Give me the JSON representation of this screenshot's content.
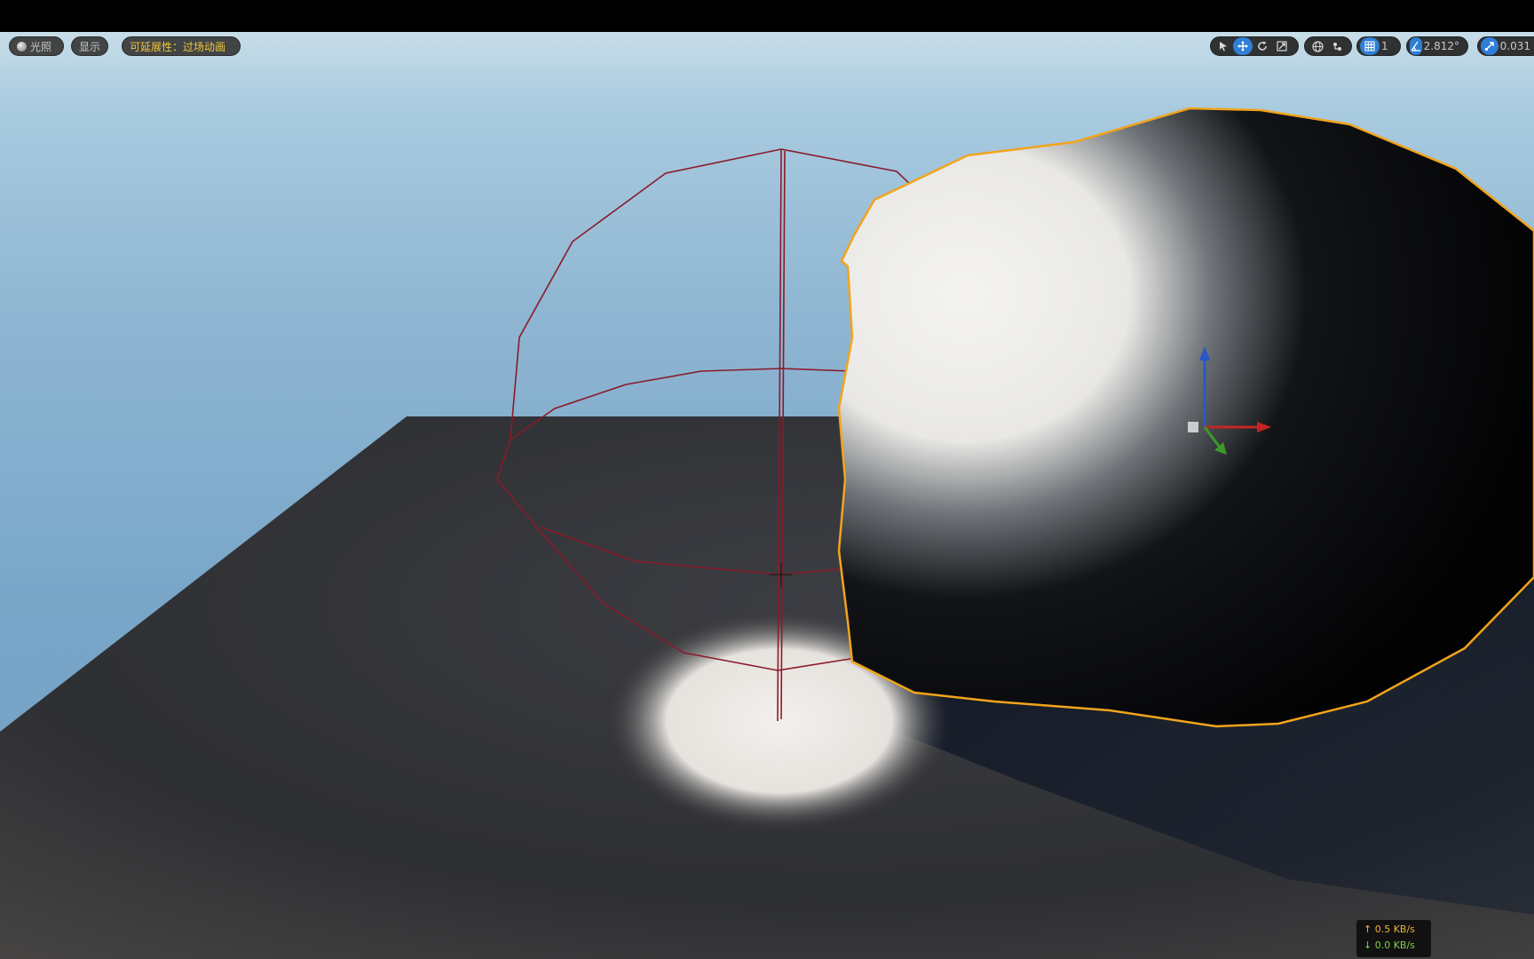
{
  "toolbar_left": {
    "lighting_label": "光照",
    "show_label": "显示",
    "scalability_label": "可延展性：过场动画"
  },
  "toolbar_right": {
    "grid_snap_value": "1",
    "rotation_snap_value": "2.812°",
    "scale_snap_value": "0.031",
    "icons": [
      "select-icon",
      "translate-icon",
      "rotate-icon",
      "scale-icon",
      "world-space-icon",
      "surface-snap-icon",
      "grid-snap-icon",
      "rotation-snap-icon",
      "scale-snap-icon"
    ]
  },
  "network_stats": {
    "upload": "↑ 0.5 KB/s",
    "download": "↓ 0.0 KB/s"
  },
  "colors": {
    "accent": "#2f7fd6",
    "selection_outline": "#f2a41c",
    "wireframe": "#8a1a2a",
    "upload": "#f0b43a",
    "download": "#7ed04a"
  }
}
